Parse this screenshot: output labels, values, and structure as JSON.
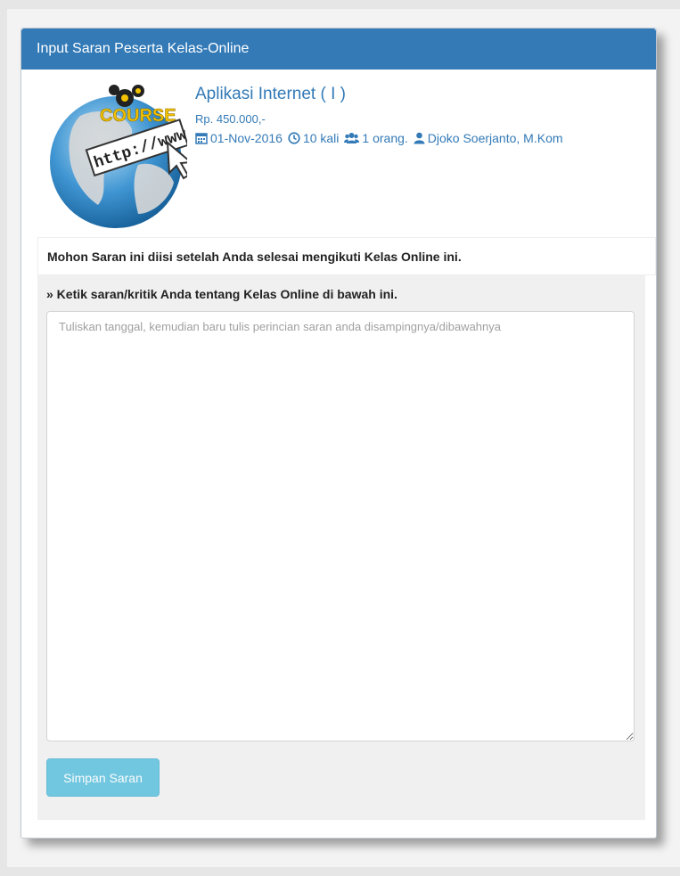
{
  "panel": {
    "heading": "Input Saran Peserta Kelas-Online"
  },
  "course": {
    "title": "Aplikasi Internet ( I )",
    "price": "Rp. 450.000,-",
    "date": "01-Nov-2016",
    "sessions": "10 kali",
    "participants": "1 orang.",
    "instructor": "Djoko Soerjanto, M.Kom",
    "thumbnail_text": {
      "course": "COURSE",
      "url": "http://www"
    }
  },
  "form": {
    "notice": "Mohon Saran ini diisi setelah Anda selesai mengikuti Kelas Online ini.",
    "label": "» Ketik saran/kritik Anda tentang Kelas Online di bawah ini.",
    "textarea_value": "",
    "textarea_placeholder": "Tuliskan tanggal, kemudian baru tulis perincian saran anda disampingnya/dibawahnya",
    "submit_label": "Simpan Saran"
  },
  "icons": {
    "date": "calendar-icon",
    "sessions": "clock-icon",
    "participants": "users-icon",
    "instructor": "user-icon"
  },
  "colors": {
    "heading_bg": "#337ab7",
    "link": "#337ab7",
    "button": "#5bc0de"
  }
}
